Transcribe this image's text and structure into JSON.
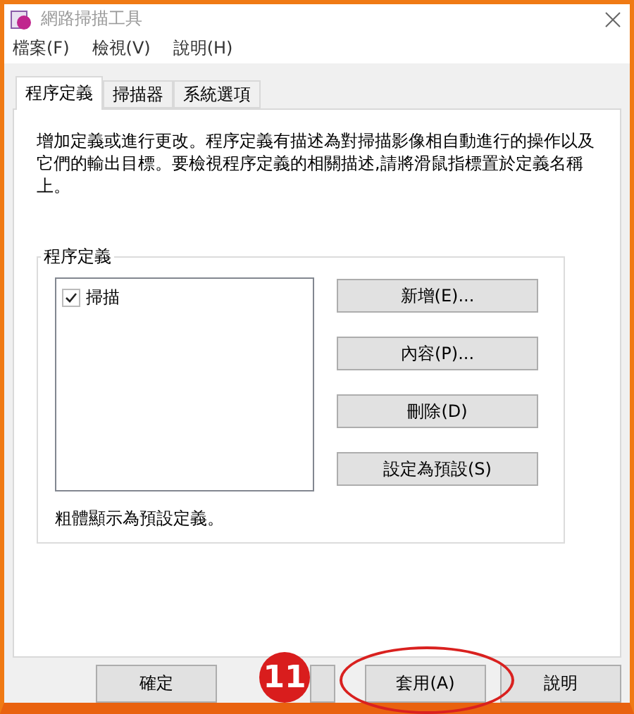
{
  "window": {
    "title": "網路掃描工具"
  },
  "menu": [
    "檔案(F)",
    "檢視(V)",
    "說明(H)"
  ],
  "tabs": [
    {
      "label": "程序定義",
      "selected": true
    },
    {
      "label": "掃描器",
      "selected": false
    },
    {
      "label": "系統選項",
      "selected": false
    }
  ],
  "description": "增加定義或進行更改。程序定義有描述為對掃描影像相自動進行的操作以及它們的輸出目標。要檢視程序定義的相關描述,請將滑鼠指標置於定義名稱上。",
  "group": {
    "title": "程序定義",
    "items": [
      {
        "label": "掃描",
        "checked": true
      }
    ],
    "actions": [
      "新增(E)...",
      "內容(P)...",
      "刪除(D)",
      "設定為預設(S)"
    ],
    "note": "粗體顯示為預設定義。"
  },
  "buttons": [
    {
      "label": "確定"
    },
    {
      "kind": "partial"
    },
    {
      "label": "套用(A)",
      "circled": true
    },
    {
      "label": "說明"
    }
  ],
  "annotation": {
    "label": "11"
  }
}
